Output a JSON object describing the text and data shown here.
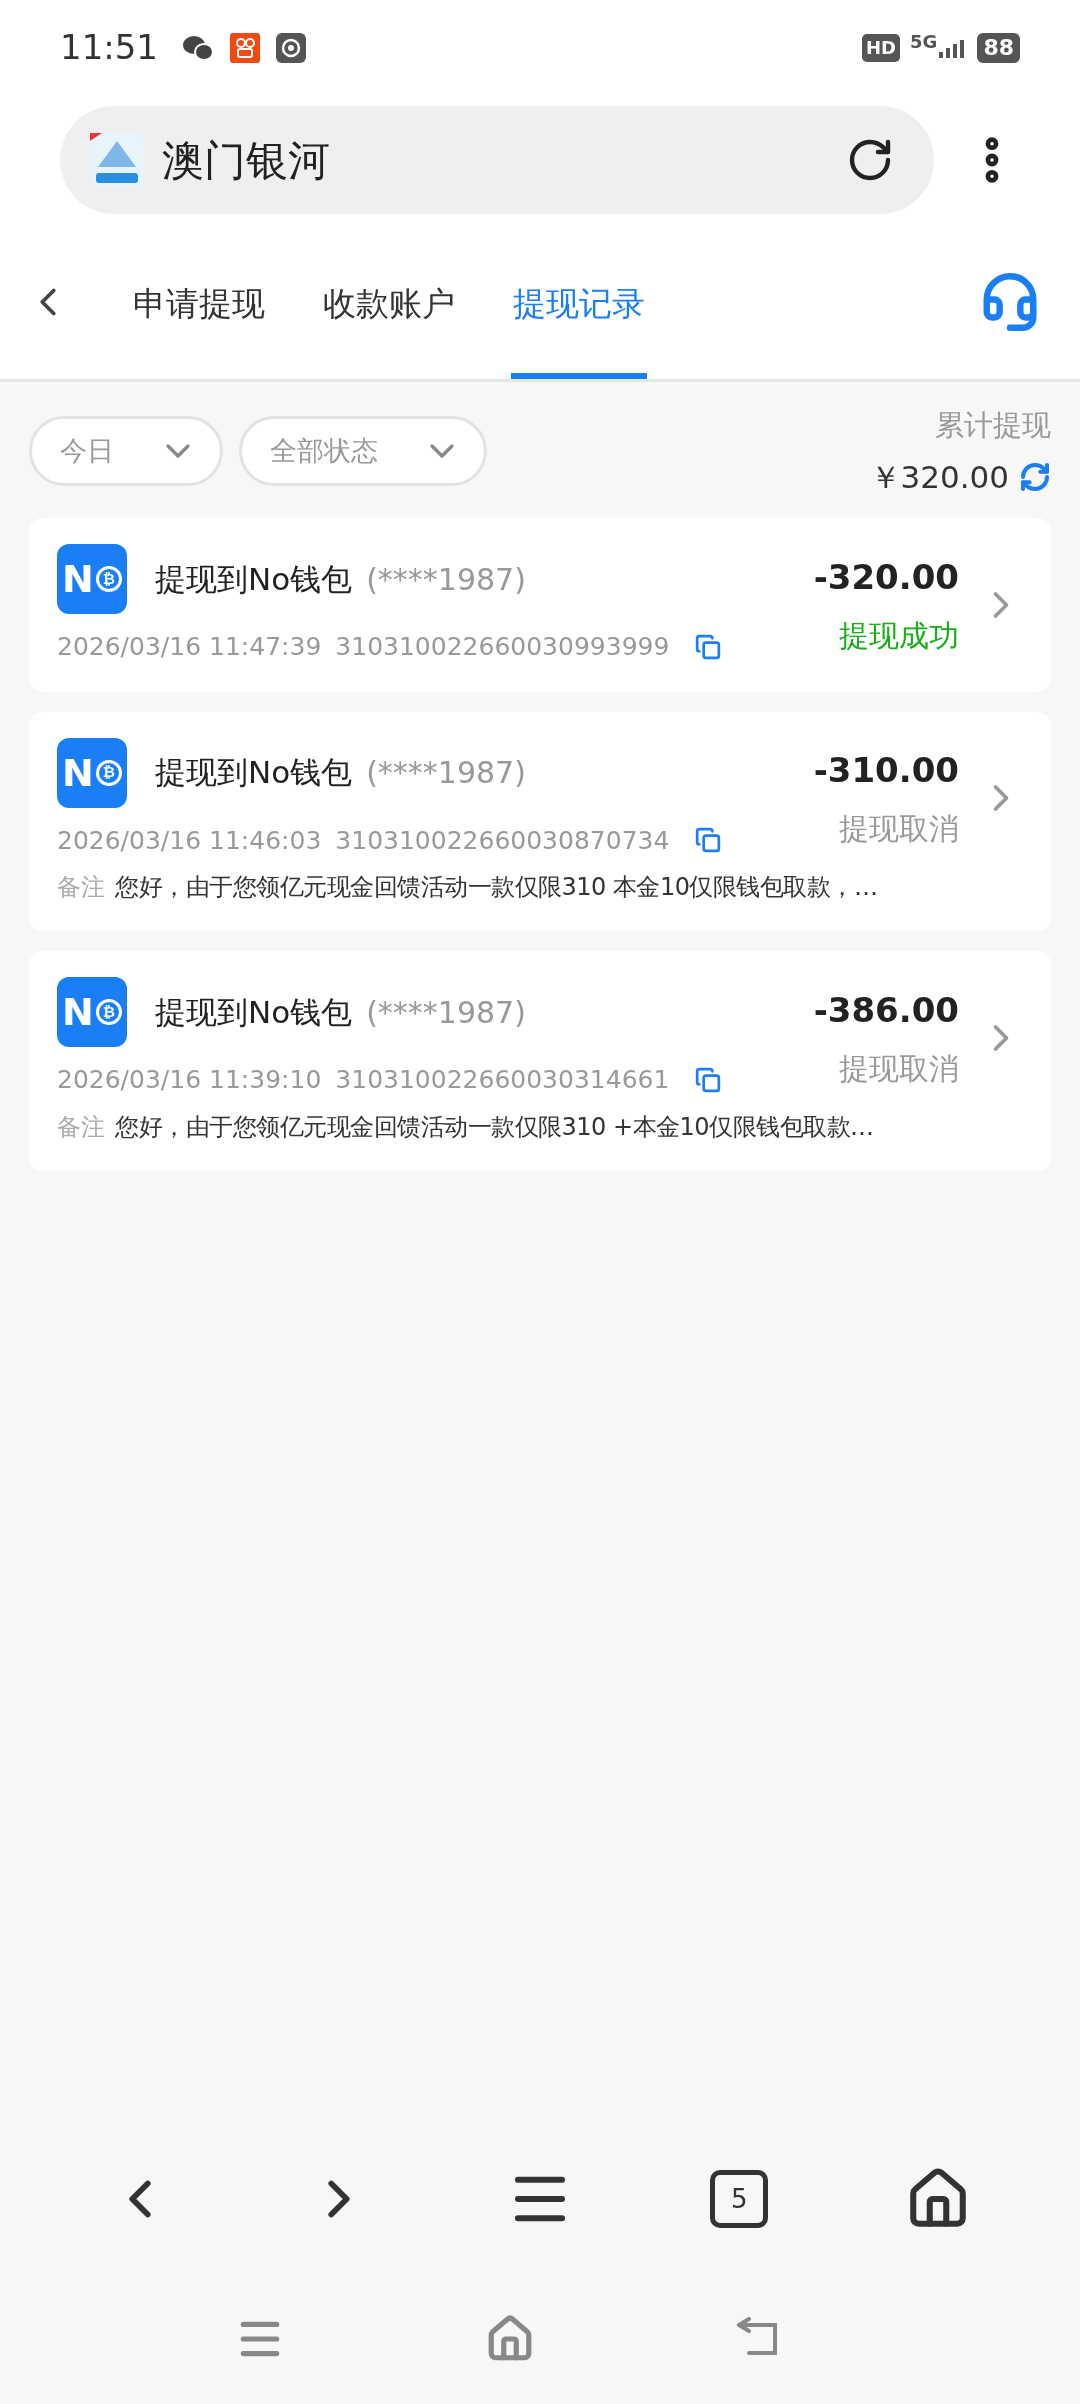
{
  "status_bar": {
    "time": "11:51",
    "network": "5G",
    "hd": "HD",
    "battery": "88"
  },
  "address_bar": {
    "title": "澳门银河"
  },
  "tabs": [
    {
      "label": "申请提现",
      "selected": false
    },
    {
      "label": "收款账户",
      "selected": false
    },
    {
      "label": "提现记录",
      "selected": true
    }
  ],
  "filters": [
    {
      "label": "今日"
    },
    {
      "label": "全部状态"
    }
  ],
  "total": {
    "label": "累计提现",
    "amount": "￥320.00"
  },
  "records": [
    {
      "logo": "N",
      "coin": "₿",
      "title": "提现到No钱包",
      "account": "(****1987)",
      "time": "2026/03/16 11:47:39",
      "order_no": "310310022660030993999",
      "amount": "-320.00",
      "status": "提现成功",
      "kind": "success"
    },
    {
      "logo": "N",
      "coin": "₿",
      "title": "提现到No钱包",
      "account": "(****1987)",
      "time": "2026/03/16 11:46:03",
      "order_no": "310310022660030870734",
      "amount": "-310.00",
      "status": "提现取消",
      "kind": "cancelled",
      "note_label": "备注",
      "note": "您好，由于您领亿元现金回馈活动一款仅限310 本金10仅限钱包取款，…"
    },
    {
      "logo": "N",
      "coin": "₿",
      "title": "提现到No钱包",
      "account": "(****1987)",
      "time": "2026/03/16 11:39:10",
      "order_no": "310310022660030314661",
      "amount": "-386.00",
      "status": "提现取消",
      "kind": "cancelled",
      "note_label": "备注",
      "note": "您好，由于您领亿元现金回馈活动一款仅限310 +本金10仅限钱包取款…"
    }
  ],
  "browser_nav": {
    "tab_count": "5"
  }
}
